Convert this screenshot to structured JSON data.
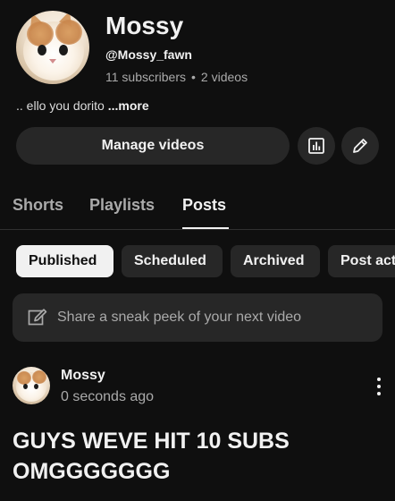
{
  "channel": {
    "name": "Mossy",
    "handle": "@Mossy_fawn",
    "subscribers": "11 subscribers",
    "stats_separator": "•",
    "videos": "2 videos",
    "description": ".. ello you dorito",
    "more_label": "...more"
  },
  "actions": {
    "manage_videos_label": "Manage videos",
    "analytics_icon": "bar-chart-icon",
    "edit_icon": "pencil-icon"
  },
  "tabs": [
    {
      "label": "Shorts",
      "active": false
    },
    {
      "label": "Playlists",
      "active": false
    },
    {
      "label": "Posts",
      "active": true
    }
  ],
  "chips": [
    {
      "label": "Published",
      "selected": true
    },
    {
      "label": "Scheduled",
      "selected": false
    },
    {
      "label": "Archived",
      "selected": false
    },
    {
      "label": "Post act",
      "selected": false
    }
  ],
  "composer": {
    "icon": "compose-icon",
    "placeholder": "Share a sneak peek of your next video"
  },
  "post": {
    "author": "Mossy",
    "time": "0 seconds ago",
    "body_line1": "GUYS WEVE HIT 10 SUBS",
    "body_line2": "OMGGGGGGG",
    "menu_icon": "more-vertical-icon"
  },
  "colors": {
    "background": "#0f0f0f",
    "surface": "#272727",
    "text_primary": "#f1f1f1",
    "text_secondary": "#aaaaaa",
    "selected_chip": "#f1f1f1"
  }
}
